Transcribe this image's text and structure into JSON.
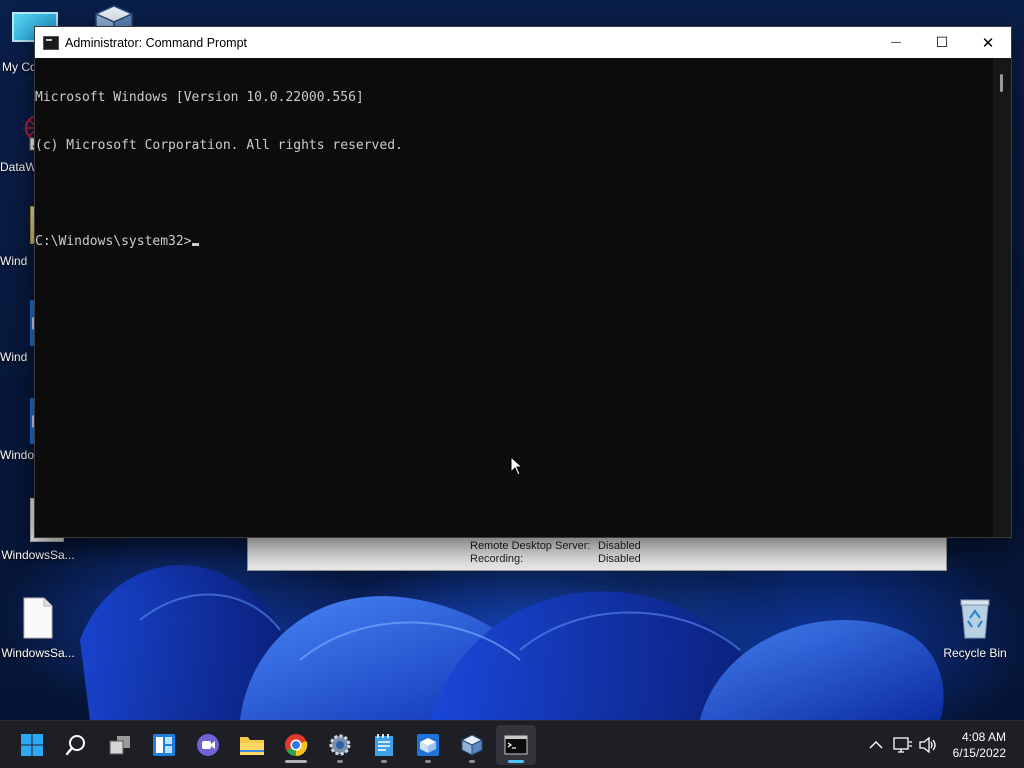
{
  "desktop": {
    "icons": [
      {
        "label": "My Co",
        "icon": "computer-icon"
      },
      {
        "label": "",
        "icon": "virtualbox-icon"
      },
      {
        "label": "DataW",
        "icon": "datawrapper-shortcut-icon"
      },
      {
        "label": "Wind",
        "icon": "folder-icon"
      },
      {
        "label": "Wind",
        "icon": "sandbox-app-icon"
      },
      {
        "label": "Windo",
        "icon": "sandbox-app-icon"
      },
      {
        "label": "WindowsSa...",
        "icon": "file-icon"
      },
      {
        "label": "WindowsSa...",
        "icon": "file-icon"
      },
      {
        "label": "Recycle Bin",
        "icon": "recycle-bin-icon"
      }
    ]
  },
  "bg_window": {
    "rows": [
      {
        "key": "Remote Desktop Server:",
        "value": "Disabled"
      },
      {
        "key": "Recording:",
        "value": "Disabled"
      }
    ]
  },
  "cmd": {
    "title": "Administrator: Command Prompt",
    "minimize_glyph": "—",
    "maximize_glyph": "☐",
    "close_glyph": "✕",
    "lines": [
      "Microsoft Windows [Version 10.0.22000.556]",
      "(c) Microsoft Corporation. All rights reserved.",
      "",
      "C:\\Windows\\system32>"
    ]
  },
  "taskbar": {
    "items": [
      {
        "name": "start-button",
        "icon": "windows-logo-icon"
      },
      {
        "name": "search-button",
        "icon": "search-icon"
      },
      {
        "name": "task-view-button",
        "icon": "task-view-icon"
      },
      {
        "name": "widgets-button",
        "icon": "widgets-icon"
      },
      {
        "name": "teams-chat-button",
        "icon": "teams-icon"
      },
      {
        "name": "file-explorer-button",
        "icon": "folder-icon"
      },
      {
        "name": "chrome-button",
        "icon": "chrome-icon"
      },
      {
        "name": "settings-button",
        "icon": "gear-icon"
      },
      {
        "name": "notepad-button",
        "icon": "notepad-icon"
      },
      {
        "name": "sandbox-button",
        "icon": "sandbox-icon"
      },
      {
        "name": "virtualbox-button",
        "icon": "virtualbox-icon"
      },
      {
        "name": "terminal-button",
        "icon": "terminal-icon"
      }
    ],
    "tray": {
      "chevron_glyph": "^",
      "time": "4:08 AM",
      "date": "6/15/2022"
    }
  }
}
